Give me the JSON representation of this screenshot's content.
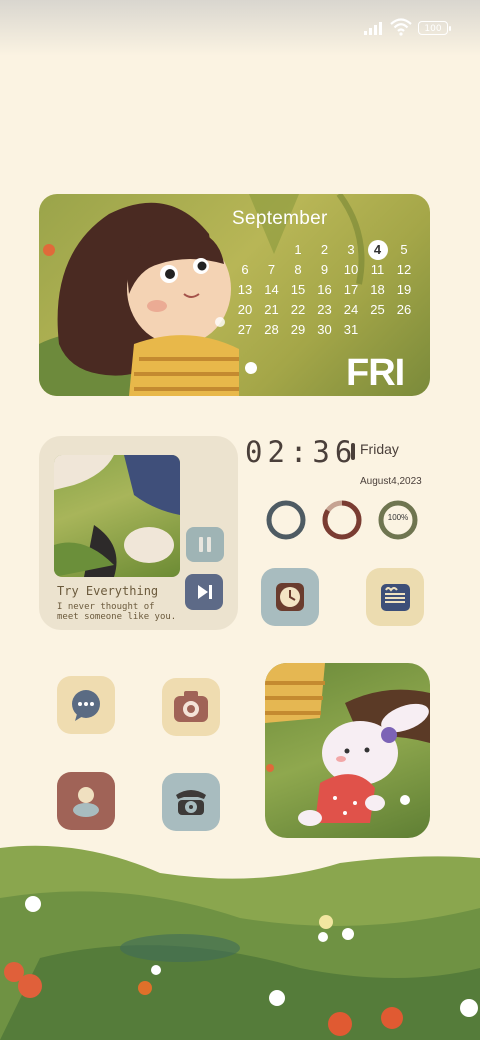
{
  "status_bar": {
    "battery": "100"
  },
  "calendar": {
    "month": "September",
    "weekday": "FRI",
    "today": "4",
    "rows": [
      [
        "",
        "",
        "1",
        "2",
        "3",
        "4",
        "5"
      ],
      [
        "6",
        "7",
        "8",
        "9",
        "10",
        "11",
        "12"
      ],
      [
        "13",
        "14",
        "15",
        "16",
        "17",
        "18",
        "19"
      ],
      [
        "20",
        "21",
        "22",
        "23",
        "24",
        "25",
        "26"
      ],
      [
        "27",
        "28",
        "29",
        "30",
        "31",
        "",
        ""
      ]
    ]
  },
  "music": {
    "title": "Try Everything",
    "lyric_line1": "I never thought of",
    "lyric_line2": "meet someone like you."
  },
  "clock": {
    "time": "02:36",
    "day": "Friday",
    "date": "August4,2023",
    "ring_label": "100%"
  },
  "icons": [
    "clock-app-icon",
    "notes-app-icon",
    "chat-app-icon",
    "camera-app-icon",
    "contacts-app-icon",
    "phone-app-icon"
  ],
  "colors": {
    "background": "#fbf3e2",
    "accent_dark": "#4a3f3a",
    "slate": "#5d6a87",
    "sage": "#a8bcbf",
    "rust": "#a06357",
    "sand": "#efdcb0"
  }
}
